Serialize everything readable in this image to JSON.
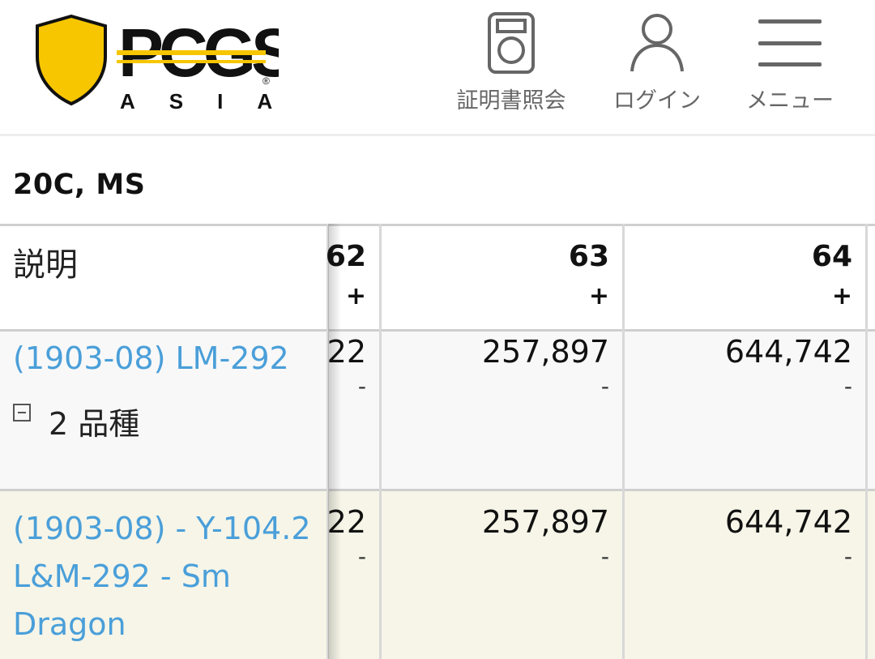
{
  "header": {
    "logo": {
      "brand": "PCGS",
      "sub": "ASIA",
      "trademark": "®",
      "shield_color": "#f7c600"
    },
    "nav": [
      {
        "label": "証明書照会",
        "icon": "certificate-icon"
      },
      {
        "label": "ログイン",
        "icon": "user-icon"
      },
      {
        "label": "メニュー",
        "icon": "hamburger-icon"
      }
    ]
  },
  "section": {
    "title": "20C, MS"
  },
  "table": {
    "description_header": "説明",
    "grades": [
      {
        "grade": "62",
        "suffix": "+"
      },
      {
        "grade": "63",
        "suffix": "+"
      },
      {
        "grade": "64",
        "suffix": "+"
      }
    ],
    "rows": [
      {
        "description": [
          "(1903-08) LM-292"
        ],
        "varieties": "2 品種",
        "cells": [
          {
            "value": "22",
            "sub": "-"
          },
          {
            "value": "257,897",
            "sub": "-"
          },
          {
            "value": "644,742",
            "sub": "-"
          }
        ]
      },
      {
        "description": [
          "(1903-08) - Y-104.2",
          "L&M-292 - Sm",
          "Dragon"
        ],
        "cells": [
          {
            "value": "22",
            "sub": "-"
          },
          {
            "value": "257,897",
            "sub": "-"
          },
          {
            "value": "644,742",
            "sub": "-"
          }
        ]
      }
    ]
  },
  "colors": {
    "link": "#4a9fd9",
    "row_alt": "#f6f5e8",
    "row_first": "#f8f8f8"
  }
}
